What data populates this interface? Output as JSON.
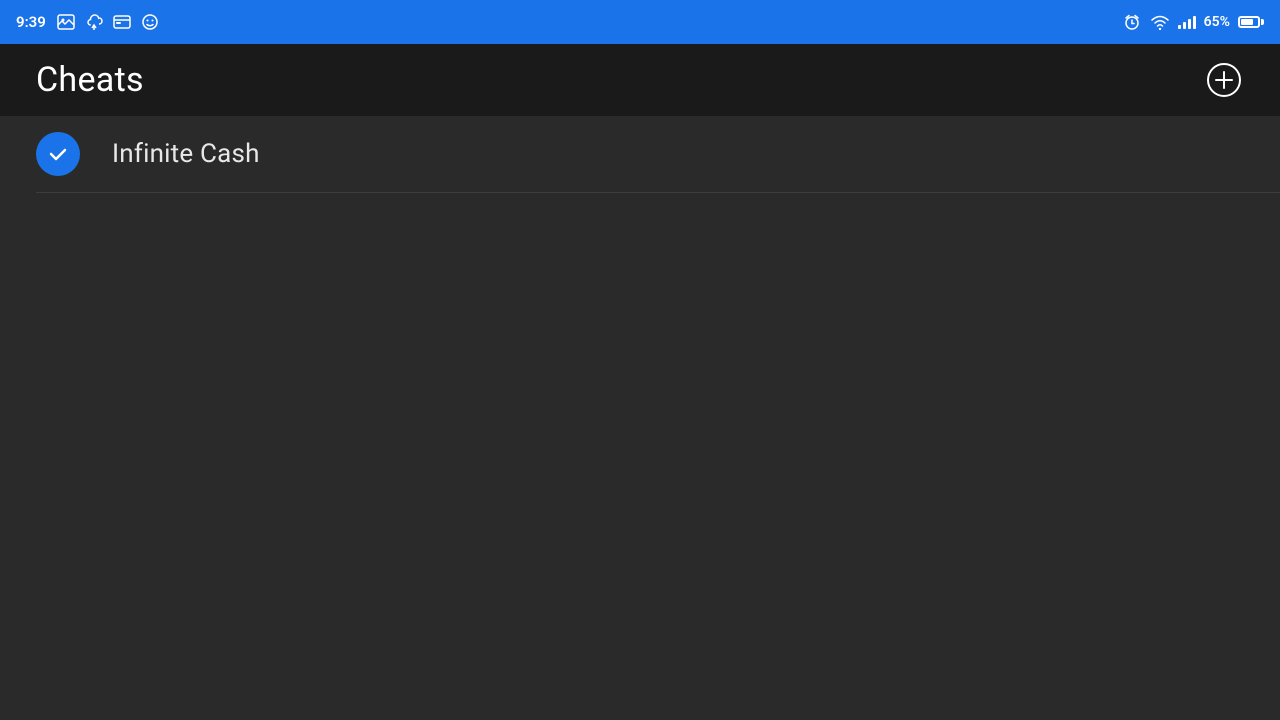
{
  "statusBar": {
    "time": "9:39",
    "batteryPercent": "65%",
    "icons": [
      "image",
      "cloud-upload",
      "card",
      "face"
    ]
  },
  "toolbar": {
    "title": "Cheats",
    "addButtonLabel": "Add"
  },
  "cheats": [
    {
      "id": 1,
      "label": "Infinite Cash",
      "enabled": true
    }
  ],
  "colors": {
    "accent": "#1a73e8",
    "background": "#2a2a2a",
    "toolbar": "#1a1a1a",
    "statusBar": "#1a73e8",
    "divider": "#3d3d3d",
    "text": "#e8e8e8"
  }
}
